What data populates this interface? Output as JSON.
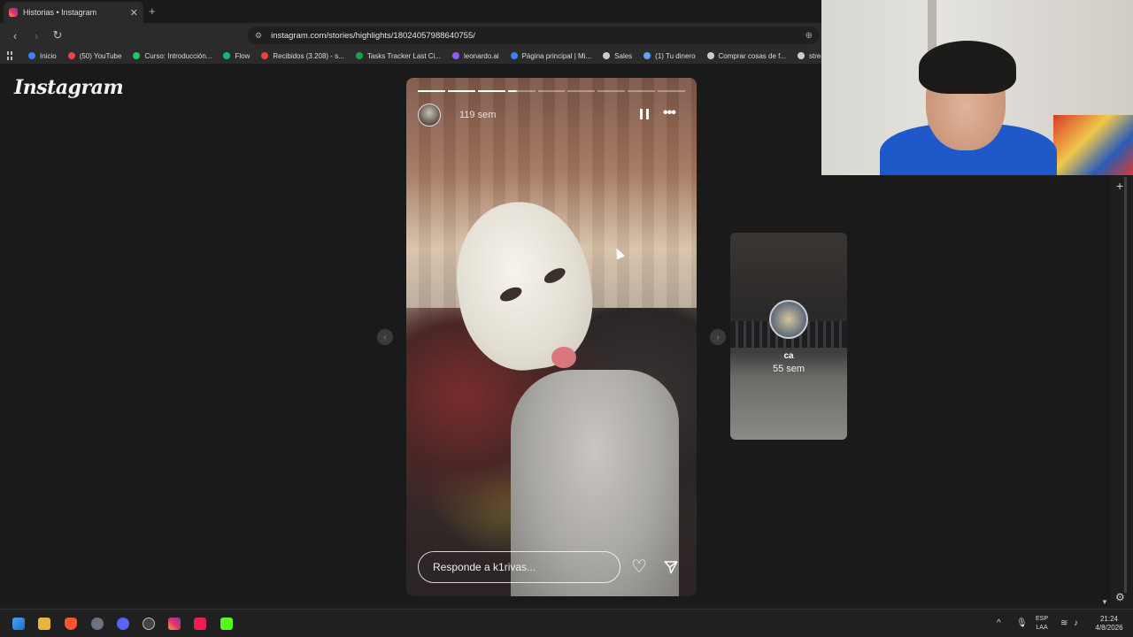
{
  "browser": {
    "tab_title": "Historias • Instagram",
    "tab_close": "✕",
    "new_tab": "+",
    "url": "instagram.com/stories/highlights/18024057988640755/",
    "bookmarks": [
      {
        "label": "Inicio",
        "color": "#3b82f6"
      },
      {
        "label": "(50) YouTube",
        "color": "#ef4444"
      },
      {
        "label": "Curso: Introducción...",
        "color": "#22c55e"
      },
      {
        "label": "Flow",
        "color": "#10b981"
      },
      {
        "label": "Recibidos (3.208) - s...",
        "color": "#ea4335"
      },
      {
        "label": "Tasks Tracker Last Ci...",
        "color": "#16a34a"
      },
      {
        "label": "leonardo.ai",
        "color": "#8b5cf6"
      },
      {
        "label": "Página principal | Mi...",
        "color": "#3b82f6"
      },
      {
        "label": "Sales",
        "color": "#cccccc"
      },
      {
        "label": "(1) Tu dinero",
        "color": "#60a5fa"
      },
      {
        "label": "Comprar cosas de f...",
        "color": "#cccccc"
      },
      {
        "label": "stream",
        "color": "#cccccc"
      }
    ]
  },
  "instagram": {
    "logo": "Instagram",
    "story": {
      "time_ago": "119 sem",
      "reply_placeholder": "Responde a k1rivas...",
      "progress_total": 9,
      "progress_done": 3,
      "progress_current_fraction": 0.3
    },
    "next_story": {
      "name": "ca",
      "time_ago": "55 sem"
    }
  },
  "taskbar": {
    "language": "ESP",
    "layout": "LAA",
    "time": "21:24",
    "date": "4/8/2026"
  },
  "colors": {
    "accent": "#0095f6",
    "background": "#1a1a1a"
  },
  "icons": [
    "back-icon",
    "forward-icon",
    "reload-icon",
    "bookmark-icon",
    "site-info-icon",
    "zoom-icon",
    "pause-icon",
    "more-icon",
    "heart-icon",
    "send-icon",
    "prev-arrow-icon",
    "next-arrow-icon",
    "gear-icon",
    "plus-icon"
  ]
}
